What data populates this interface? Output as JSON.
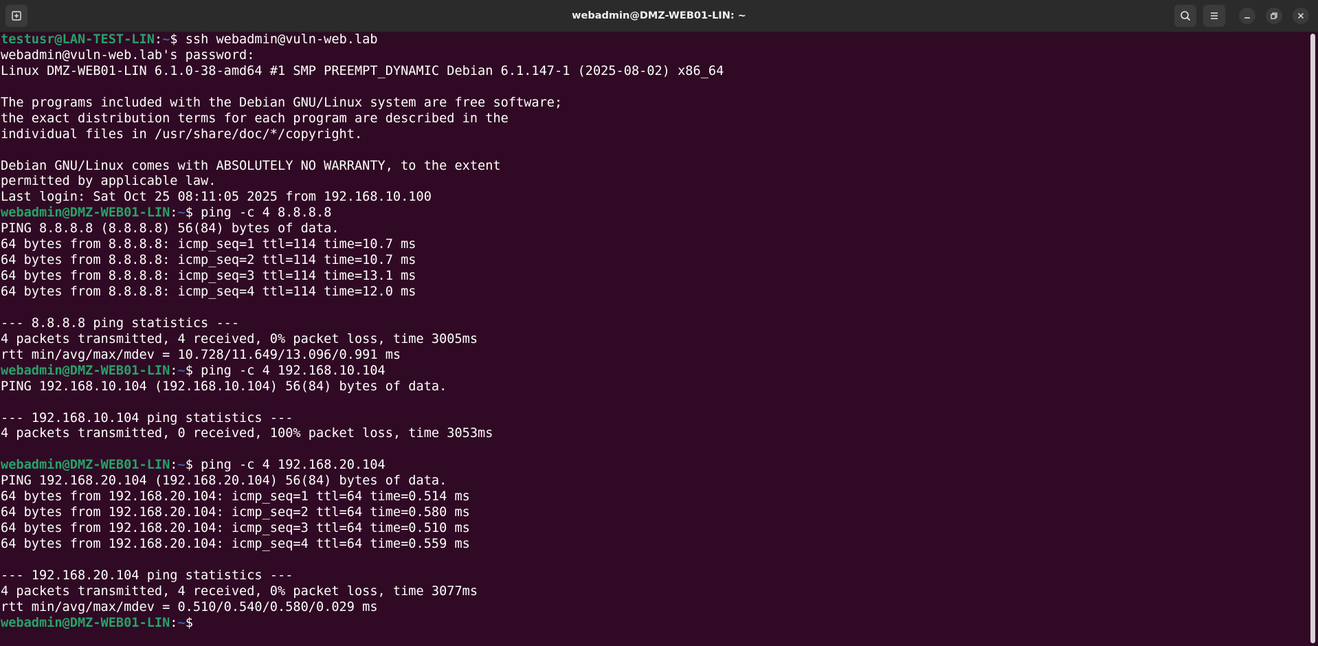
{
  "window": {
    "title": "webadmin@DMZ-WEB01-LIN: ~"
  },
  "colors": {
    "background": "#300a24",
    "titlebar": "#2b2b2b",
    "prompt_user": "#26a269",
    "prompt_path": "#3465a4",
    "text": "#ffffff"
  },
  "icons": {
    "new_tab": "new-tab-icon",
    "search": "search-icon",
    "menu": "hamburger-menu-icon",
    "minimize": "minimize-icon",
    "maximize": "restore-icon",
    "close": "close-icon"
  },
  "terminal": {
    "lines": [
      {
        "user": "testusr@LAN-TEST-LIN",
        "sep": ":",
        "path": "~",
        "dollar": "$ ",
        "text": "ssh webadmin@vuln-web.lab"
      },
      {
        "text": "webadmin@vuln-web.lab's password:"
      },
      {
        "text": "Linux DMZ-WEB01-LIN 6.1.0-38-amd64 #1 SMP PREEMPT_DYNAMIC Debian 6.1.147-1 (2025-08-02) x86_64"
      },
      {
        "text": ""
      },
      {
        "text": "The programs included with the Debian GNU/Linux system are free software;"
      },
      {
        "text": "the exact distribution terms for each program are described in the"
      },
      {
        "text": "individual files in /usr/share/doc/*/copyright."
      },
      {
        "text": ""
      },
      {
        "text": "Debian GNU/Linux comes with ABSOLUTELY NO WARRANTY, to the extent"
      },
      {
        "text": "permitted by applicable law."
      },
      {
        "text": "Last login: Sat Oct 25 08:11:05 2025 from 192.168.10.100"
      },
      {
        "user": "webadmin@DMZ-WEB01-LIN",
        "sep": ":",
        "path": "~",
        "dollar": "$ ",
        "text": "ping -c 4 8.8.8.8"
      },
      {
        "text": "PING 8.8.8.8 (8.8.8.8) 56(84) bytes of data."
      },
      {
        "text": "64 bytes from 8.8.8.8: icmp_seq=1 ttl=114 time=10.7 ms"
      },
      {
        "text": "64 bytes from 8.8.8.8: icmp_seq=2 ttl=114 time=10.7 ms"
      },
      {
        "text": "64 bytes from 8.8.8.8: icmp_seq=3 ttl=114 time=13.1 ms"
      },
      {
        "text": "64 bytes from 8.8.8.8: icmp_seq=4 ttl=114 time=12.0 ms"
      },
      {
        "text": ""
      },
      {
        "text": "--- 8.8.8.8 ping statistics ---"
      },
      {
        "text": "4 packets transmitted, 4 received, 0% packet loss, time 3005ms"
      },
      {
        "text": "rtt min/avg/max/mdev = 10.728/11.649/13.096/0.991 ms"
      },
      {
        "user": "webadmin@DMZ-WEB01-LIN",
        "sep": ":",
        "path": "~",
        "dollar": "$ ",
        "text": "ping -c 4 192.168.10.104"
      },
      {
        "text": "PING 192.168.10.104 (192.168.10.104) 56(84) bytes of data."
      },
      {
        "text": ""
      },
      {
        "text": "--- 192.168.10.104 ping statistics ---"
      },
      {
        "text": "4 packets transmitted, 0 received, 100% packet loss, time 3053ms"
      },
      {
        "text": ""
      },
      {
        "user": "webadmin@DMZ-WEB01-LIN",
        "sep": ":",
        "path": "~",
        "dollar": "$ ",
        "text": "ping -c 4 192.168.20.104"
      },
      {
        "text": "PING 192.168.20.104 (192.168.20.104) 56(84) bytes of data."
      },
      {
        "text": "64 bytes from 192.168.20.104: icmp_seq=1 ttl=64 time=0.514 ms"
      },
      {
        "text": "64 bytes from 192.168.20.104: icmp_seq=2 ttl=64 time=0.580 ms"
      },
      {
        "text": "64 bytes from 192.168.20.104: icmp_seq=3 ttl=64 time=0.510 ms"
      },
      {
        "text": "64 bytes from 192.168.20.104: icmp_seq=4 ttl=64 time=0.559 ms"
      },
      {
        "text": ""
      },
      {
        "text": "--- 192.168.20.104 ping statistics ---"
      },
      {
        "text": "4 packets transmitted, 4 received, 0% packet loss, time 3077ms"
      },
      {
        "text": "rtt min/avg/max/mdev = 0.510/0.540/0.580/0.029 ms"
      },
      {
        "user": "webadmin@DMZ-WEB01-LIN",
        "sep": ":",
        "path": "~",
        "dollar": "$",
        "text": ""
      }
    ]
  }
}
